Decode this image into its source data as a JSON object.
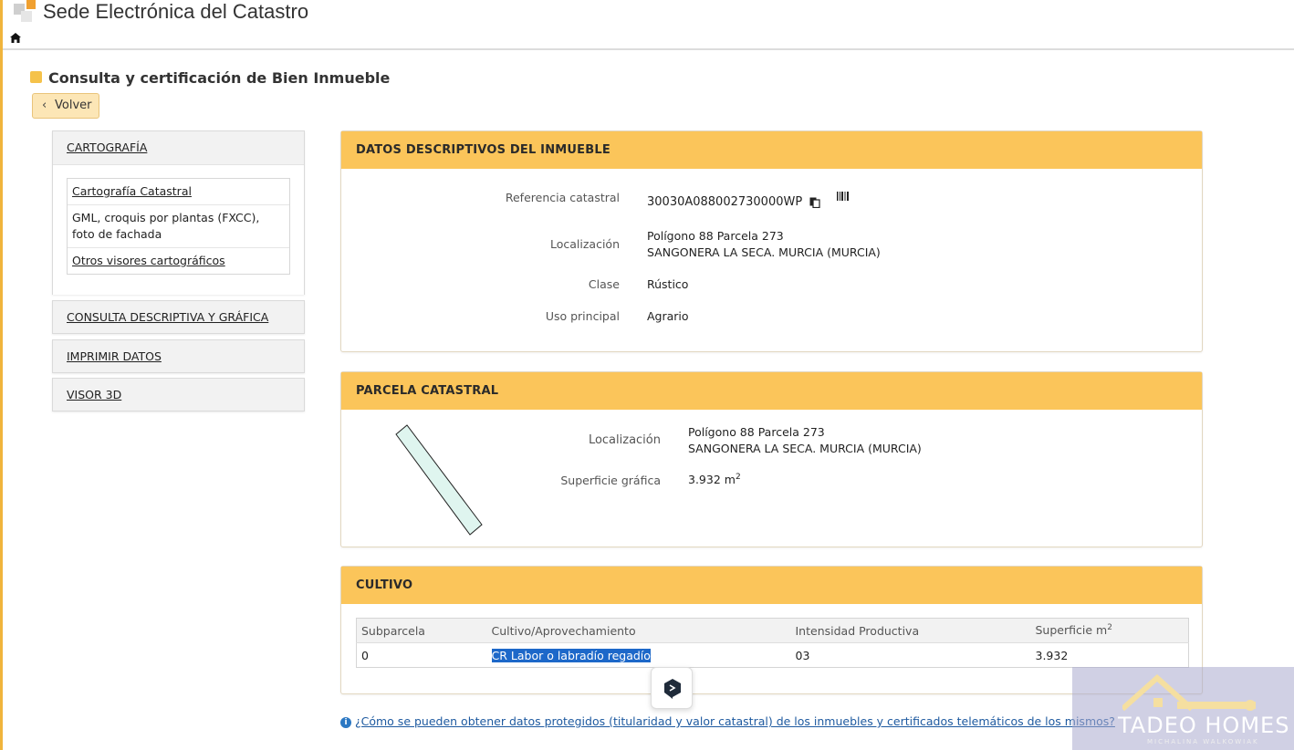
{
  "header": {
    "app_title": "Sede Electrónica del Catastro"
  },
  "page": {
    "title": "Consulta y certificación de Bien Inmueble",
    "back_label": "Volver"
  },
  "sidebar": {
    "cartografia": {
      "title": "CARTOGRAFÍA",
      "items": [
        {
          "label": "Cartografía Catastral"
        },
        {
          "label": "GML, croquis por plantas (FXCC), foto de fachada"
        },
        {
          "label": "Otros visores cartográficos"
        }
      ]
    },
    "consulta": {
      "title": "CONSULTA DESCRIPTIVA Y GRÁFICA"
    },
    "imprimir": {
      "title": "IMPRIMIR DATOS"
    },
    "visor": {
      "title": "VISOR 3D"
    }
  },
  "datos": {
    "title": "DATOS DESCRIPTIVOS DEL INMUEBLE",
    "referencia_label": "Referencia catastral",
    "referencia_value": "30030A088002730000WP",
    "localizacion_label": "Localización",
    "localizacion_line1": "Polígono 88 Parcela 273",
    "localizacion_line2": "SANGONERA LA SECA. MURCIA (MURCIA)",
    "clase_label": "Clase",
    "clase_value": "Rústico",
    "uso_label": "Uso principal",
    "uso_value": "Agrario"
  },
  "parcela": {
    "title": "PARCELA CATASTRAL",
    "localizacion_label": "Localización",
    "localizacion_line1": "Polígono 88 Parcela 273",
    "localizacion_line2": "SANGONERA LA SECA. MURCIA (MURCIA)",
    "superficie_label": "Superficie gráfica",
    "superficie_value": "3.932 m",
    "superficie_sup": "2"
  },
  "cultivo": {
    "title": "CULTIVO",
    "columns": [
      "Subparcela",
      "Cultivo/Aprovechamiento",
      "Intensidad Productiva",
      "Superficie m"
    ],
    "superficie_sup": "2",
    "rows": [
      {
        "subparcela": "0",
        "cultivo": "CR Labor o labradío regadío",
        "intensidad": "03",
        "superficie": "3.932"
      }
    ]
  },
  "footer": {
    "info_link": "¿Cómo se pueden obtener datos protegidos (titularidad y valor catastral) de los inmuebles y certificados telemáticos de los mismos?"
  },
  "watermark": {
    "name": "TADEO HOMES",
    "sub": "MICHALINA WALKOWIAK"
  },
  "colors": {
    "accent": "#fbc55a",
    "selection": "#1d68c9"
  }
}
